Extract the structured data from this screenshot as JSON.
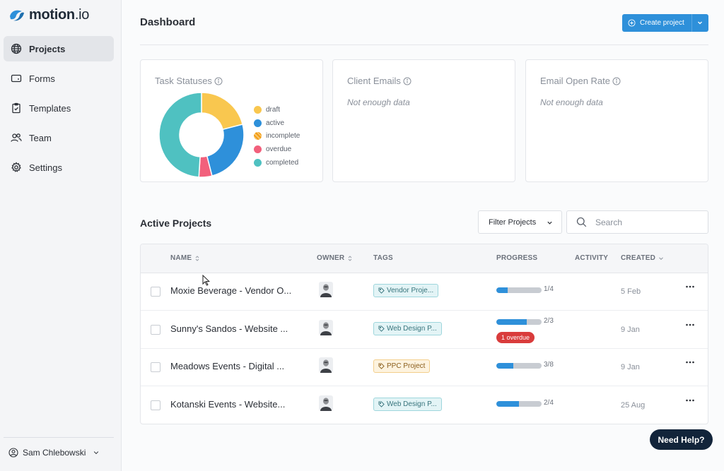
{
  "brand": {
    "name": "motion",
    "suffix": ".io"
  },
  "sidebar": {
    "items": [
      {
        "label": "Projects",
        "icon": "globe-icon"
      },
      {
        "label": "Forms",
        "icon": "form-icon"
      },
      {
        "label": "Templates",
        "icon": "clipboard-check-icon"
      },
      {
        "label": "Team",
        "icon": "users-icon"
      },
      {
        "label": "Settings",
        "icon": "gear-icon"
      }
    ],
    "user": "Sam Chlebowski"
  },
  "header": {
    "title": "Dashboard",
    "create_label": "Create project"
  },
  "cards": {
    "task_statuses": {
      "title": "Task Statuses",
      "legend": [
        "draft",
        "active",
        "incomplete",
        "overdue",
        "completed"
      ]
    },
    "client_emails": {
      "title": "Client Emails",
      "empty": "Not enough data"
    },
    "email_open_rate": {
      "title": "Email Open Rate",
      "empty": "Not enough data"
    }
  },
  "chart_data": {
    "type": "pie",
    "categories": [
      "draft",
      "active",
      "incomplete",
      "overdue",
      "completed"
    ],
    "values": [
      21,
      25,
      0,
      5,
      49
    ],
    "colors": [
      "#f9c74f",
      "#2e90da",
      "#f39c12",
      "#f2607c",
      "#4fc1c1"
    ]
  },
  "projects": {
    "title": "Active Projects",
    "filter_label": "Filter Projects",
    "search_placeholder": "Search",
    "columns": [
      "NAME",
      "OWNER",
      "TAGS",
      "PROGRESS",
      "ACTIVITY",
      "CREATED"
    ],
    "rows": [
      {
        "name": "Moxie Beverage - Vendor O...",
        "tag": "Vendor Proje...",
        "tag_color": "teal",
        "done": 1,
        "total": 4,
        "progress_label": "1/4",
        "overdue": "",
        "created": "5 Feb"
      },
      {
        "name": "Sunny's Sandos - Website ...",
        "tag": "Web Design P...",
        "tag_color": "teal",
        "done": 2,
        "total": 3,
        "progress_label": "2/3",
        "overdue": "1 overdue",
        "created": "9 Jan"
      },
      {
        "name": "Meadows Events - Digital ...",
        "tag": "PPC Project",
        "tag_color": "orange",
        "done": 3,
        "total": 8,
        "progress_label": "3/8",
        "overdue": "",
        "created": "9 Jan"
      },
      {
        "name": "Kotanski Events - Website...",
        "tag": "Web Design P...",
        "tag_color": "teal",
        "done": 2,
        "total": 4,
        "progress_label": "2/4",
        "overdue": "",
        "created": "25 Aug"
      }
    ]
  },
  "help_label": "Need Help?"
}
